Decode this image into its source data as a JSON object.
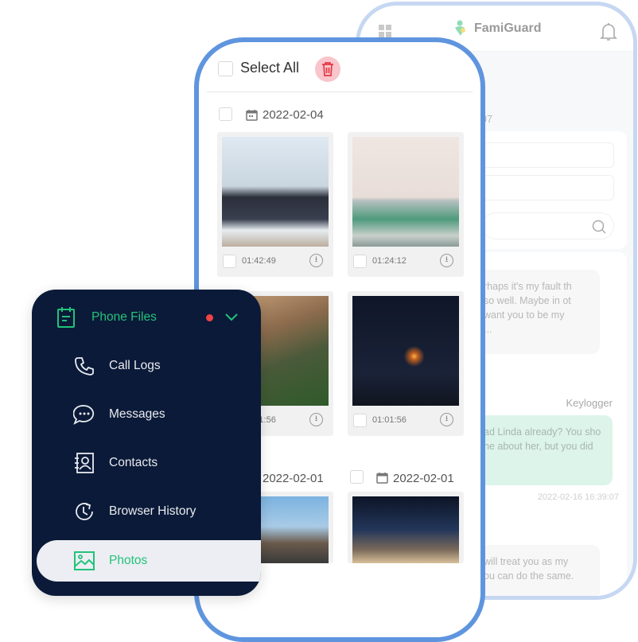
{
  "back_phone": {
    "brand": "FamiGuard",
    "partial_timestamp": "07",
    "message_1": [
      "rhaps it's my fault th",
      "so well. Maybe in ot",
      "want you to be my",
      "..."
    ],
    "source_label": "Keylogger",
    "message_2": [
      "ad Linda already? You sho",
      "ne about her, but you did"
    ],
    "message_2_time": "2022-02-16 16:39:07",
    "message_3": [
      "will treat you as my",
      "ou can do the same."
    ],
    "icons": [
      "grid-icon",
      "logo-icon",
      "bell-icon",
      "search-icon"
    ]
  },
  "photos": {
    "select_all": "Select All",
    "groups": [
      {
        "date": "2022-02-04",
        "items": [
          {
            "time": "01:42:49"
          },
          {
            "time": "01:24:12"
          },
          {
            "time": "01:01:56"
          },
          {
            "time": "01:01:56"
          }
        ]
      },
      {
        "date": "2022-02-01"
      },
      {
        "date": "2022-02-01"
      }
    ],
    "accent_delete": "#e63946"
  },
  "sidebar": {
    "section": "Phone Files",
    "items": [
      {
        "label": "Call Logs",
        "icon": "phone-icon"
      },
      {
        "label": "Messages",
        "icon": "chat-icon"
      },
      {
        "label": "Contacts",
        "icon": "contacts-icon"
      },
      {
        "label": "Browser History",
        "icon": "history-icon"
      },
      {
        "label": "Photos",
        "icon": "image-icon",
        "active": true
      }
    ],
    "accent": "#23c27a",
    "bg": "#0b1a38"
  }
}
